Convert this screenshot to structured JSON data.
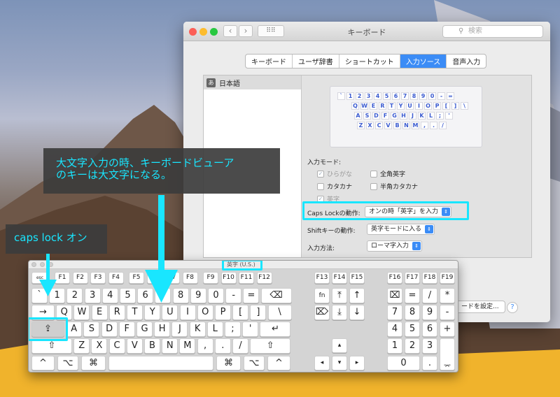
{
  "window": {
    "title": "キーボード",
    "search_placeholder": "検索",
    "tabs": [
      "キーボード",
      "ユーザ辞書",
      "ショートカット",
      "入力ソース",
      "音声入力"
    ],
    "active_tab": "入力ソース",
    "source_list": [
      {
        "icon": "あ",
        "label": "日本語"
      }
    ],
    "mini_keyboard_rows": [
      [
        "`",
        "1",
        "2",
        "3",
        "4",
        "5",
        "6",
        "7",
        "8",
        "9",
        "0",
        "-",
        "="
      ],
      [
        "Q",
        "W",
        "E",
        "R",
        "T",
        "Y",
        "U",
        "I",
        "O",
        "P",
        "[",
        "]",
        "\\"
      ],
      [
        "A",
        "S",
        "D",
        "F",
        "G",
        "H",
        "J",
        "K",
        "L",
        ";",
        "'"
      ],
      [
        "Z",
        "X",
        "C",
        "V",
        "B",
        "N",
        "M",
        ",",
        ".",
        "/"
      ]
    ],
    "input_mode_label": "入力モード:",
    "modes": [
      {
        "label": "ひらがな",
        "checked": true,
        "dim": true
      },
      {
        "label": "全角英字",
        "checked": false,
        "dim": false
      },
      {
        "label": "カタカナ",
        "checked": false,
        "dim": false
      },
      {
        "label": "半角カタカナ",
        "checked": false,
        "dim": false
      },
      {
        "label": "英字",
        "checked": true,
        "dim": true
      }
    ],
    "caps_label": "Caps Lockの動作:",
    "caps_value": "オンの時「英字」を入力",
    "shift_label": "Shiftキーの動作:",
    "shift_value": "英字モードに入る",
    "method_label": "入力方法:",
    "method_value": "ローマ字入力",
    "settings_button": "ードを設定...",
    "help": "?"
  },
  "viewer": {
    "title": "英字 (U.S.)",
    "esc": "esc",
    "fkeys": [
      "F1",
      "F2",
      "F3",
      "F4",
      "F5",
      "F6",
      "F7",
      "F8",
      "F9",
      "F10",
      "F11",
      "F12"
    ],
    "row1": [
      "`",
      "1",
      "2",
      "3",
      "4",
      "5",
      "6",
      "7",
      "8",
      "9",
      "0",
      "-",
      "=",
      "⌫"
    ],
    "row2": [
      "→",
      "Q",
      "W",
      "E",
      "R",
      "T",
      "Y",
      "U",
      "I",
      "O",
      "P",
      "[",
      "]",
      "\\"
    ],
    "row3": [
      "⇪",
      "A",
      "S",
      "D",
      "F",
      "G",
      "H",
      "J",
      "K",
      "L",
      ";",
      "'",
      "↵"
    ],
    "row4": [
      "⇧",
      "Z",
      "X",
      "C",
      "V",
      "B",
      "N",
      "M",
      ",",
      ".",
      "/",
      "⇧"
    ],
    "row5": [
      "^",
      "⌥",
      "⌘",
      "⌘",
      "⌥",
      "^"
    ],
    "nav_f": [
      "F13",
      "F14",
      "F15"
    ],
    "nav1": [
      "fn",
      "⤒",
      "↑"
    ],
    "nav2": [
      "⌦",
      "⤓",
      "↓"
    ],
    "arrows": [
      "▴",
      "◂",
      "▾",
      "▸"
    ],
    "pad_f": [
      "F16",
      "F17",
      "F18",
      "F19"
    ],
    "pad1": [
      "⌧",
      "=",
      "/",
      "*"
    ],
    "pad2": [
      "7",
      "8",
      "9",
      "-"
    ],
    "pad3": [
      "4",
      "5",
      "6",
      "+"
    ],
    "pad4": [
      "1",
      "2",
      "3"
    ],
    "pad5": [
      "0",
      "."
    ],
    "enter": "⌤"
  },
  "callouts": {
    "caps": "caps lock オン",
    "viewer_line1": "大文字入力の時、キーボードビューア",
    "viewer_line2": "のキーは大文字になる。"
  },
  "colors": {
    "accent": "#19e6ff",
    "blue": "#3b8cf6"
  }
}
